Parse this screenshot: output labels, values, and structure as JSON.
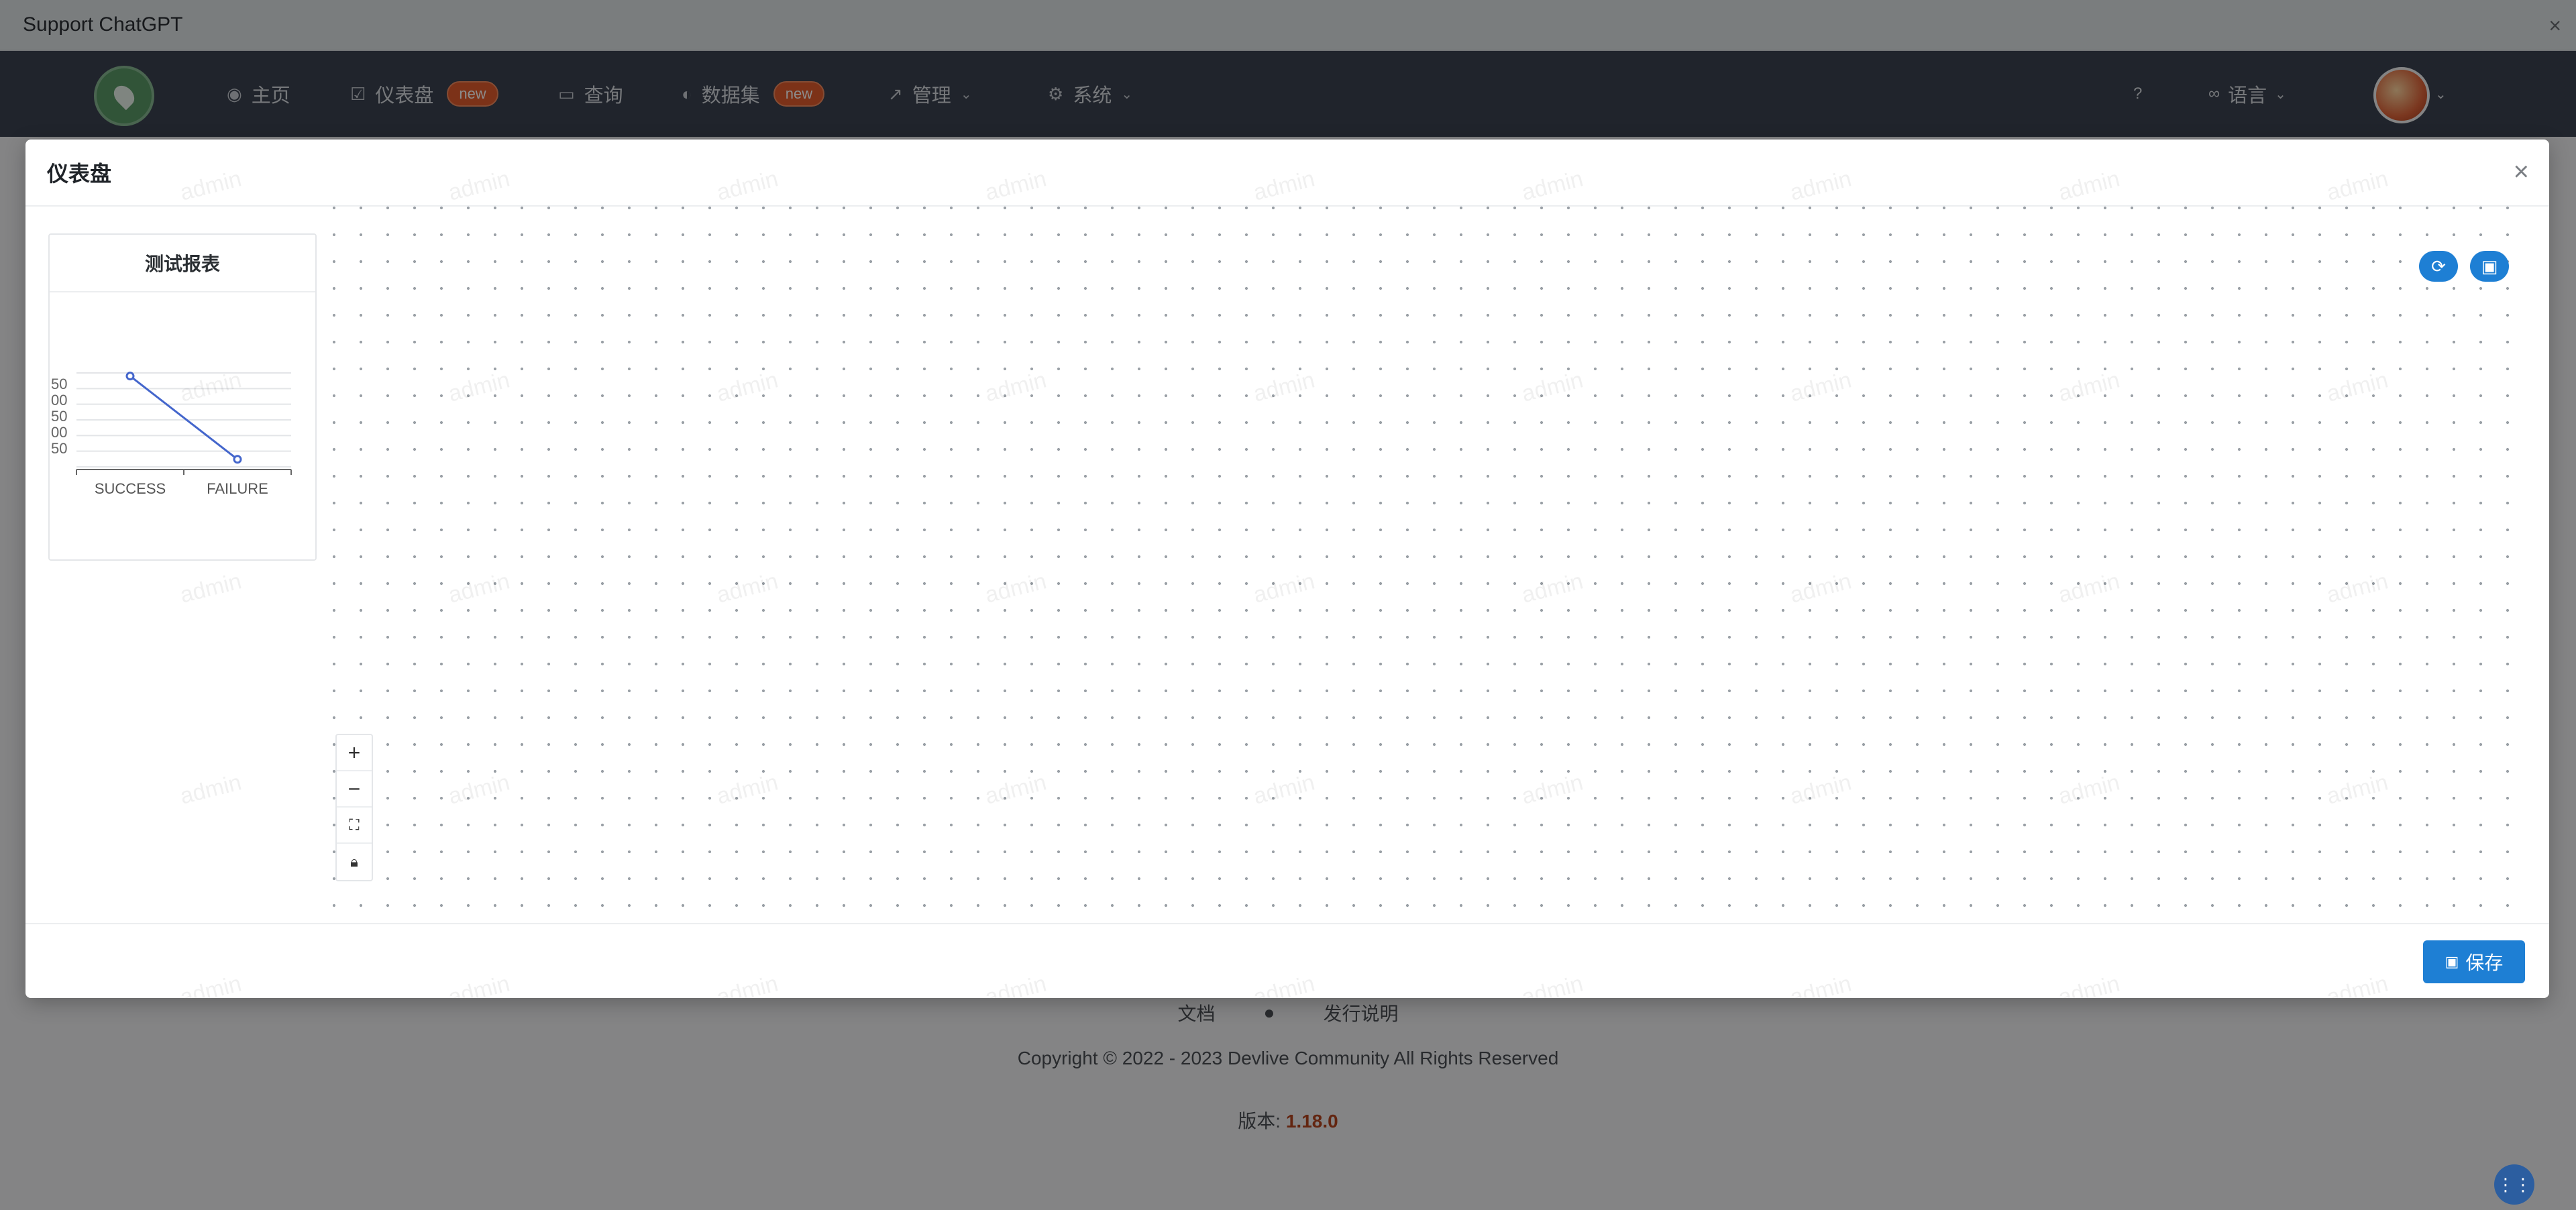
{
  "banner": {
    "title": "Support ChatGPT",
    "close": "×"
  },
  "nav": {
    "items": [
      {
        "label": "主页",
        "icon": "compass-icon"
      },
      {
        "label": "仪表盘",
        "icon": "chart-icon",
        "badge": "new"
      },
      {
        "label": "查询",
        "icon": "calendar-icon"
      },
      {
        "label": "数据集",
        "icon": "contrast-icon",
        "badge": "new"
      },
      {
        "label": "管理",
        "icon": "arrow-up-right-icon"
      },
      {
        "label": "系统",
        "icon": "gear-icon"
      }
    ],
    "help_icon": "question-icon",
    "language": "语言"
  },
  "modal": {
    "title": "仪表盘",
    "close": "×",
    "save_label": "保存"
  },
  "card": {
    "title": "测试报表"
  },
  "chart_data": {
    "type": "line",
    "categories": [
      "SUCCESS",
      "FAILURE"
    ],
    "values": [
      290,
      24
    ],
    "y_tick_labels": [
      "50",
      "00",
      "50",
      "00",
      "50"
    ]
  },
  "watermark": "admin",
  "footer": {
    "docs": "文档",
    "release": "发行说明",
    "copyright": "Copyright © 2022 - 2023 Devlive Community All Rights Reserved",
    "version_label": "版本:",
    "version": "1.18.0"
  },
  "colors": {
    "accent": "#1e7fd4",
    "navbar": "#3b4350",
    "badge": "#e25b2c"
  }
}
